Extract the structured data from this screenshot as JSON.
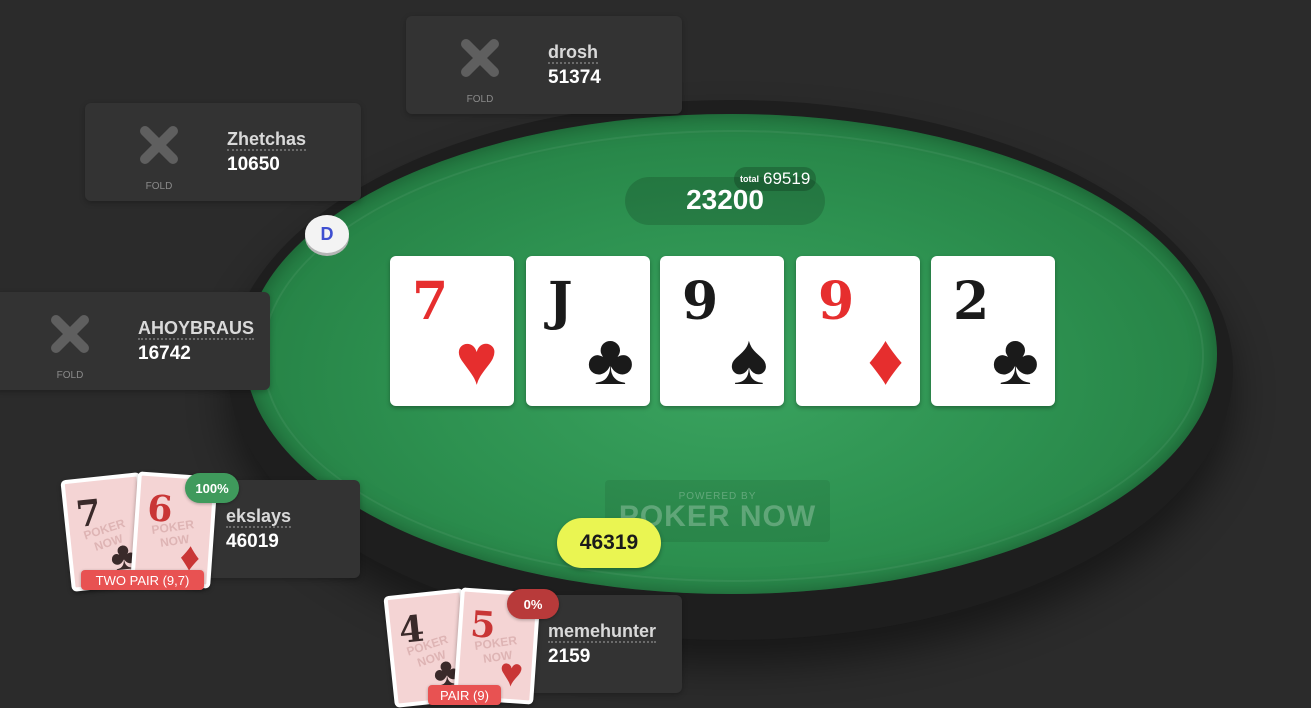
{
  "pot": {
    "current": "23200",
    "total_label": "total",
    "total_value": "69519"
  },
  "board": {
    "cards": [
      {
        "rank": "7",
        "suit": "♥",
        "color": "red"
      },
      {
        "rank": "J",
        "suit": "♣",
        "color": "black"
      },
      {
        "rank": "9",
        "suit": "♠",
        "color": "black"
      },
      {
        "rank": "9",
        "suit": "♦",
        "color": "red"
      },
      {
        "rank": "2",
        "suit": "♣",
        "color": "black"
      }
    ]
  },
  "branding": {
    "powered_by": "POWERED BY",
    "logo": "POKER NOW"
  },
  "dealer_button": "D",
  "bet": "46319",
  "players": {
    "drosh": {
      "name": "drosh",
      "stack": "51374",
      "status": "FOLD"
    },
    "zhetchas": {
      "name": "Zhetchas",
      "stack": "10650",
      "status": "FOLD"
    },
    "ahoybraus": {
      "name": "AHOYBRAUS",
      "stack": "16742",
      "status": "FOLD"
    },
    "ekslays": {
      "name": "ekslays",
      "stack": "46019",
      "equity": "100%",
      "equity_color": "#3f9a5c",
      "hand": "TWO PAIR (9,7)",
      "cards": [
        {
          "rank": "7",
          "suit": "♣",
          "color": "black"
        },
        {
          "rank": "6",
          "suit": "♦",
          "color": "red"
        }
      ]
    },
    "memehunter": {
      "name": "memehunter",
      "stack": "2159",
      "equity": "0%",
      "equity_color": "#b83a3a",
      "hand": "PAIR (9)",
      "cards": [
        {
          "rank": "4",
          "suit": "♣",
          "color": "black"
        },
        {
          "rank": "5",
          "suit": "♥",
          "color": "red"
        }
      ]
    }
  },
  "watermark": "POKER NOW",
  "colors": {
    "background": "#2b2b2b",
    "felt": "#2d9150",
    "bet_chip": "#eaf552",
    "hand_label": "#e85252",
    "card_red": "#e62e2e"
  }
}
